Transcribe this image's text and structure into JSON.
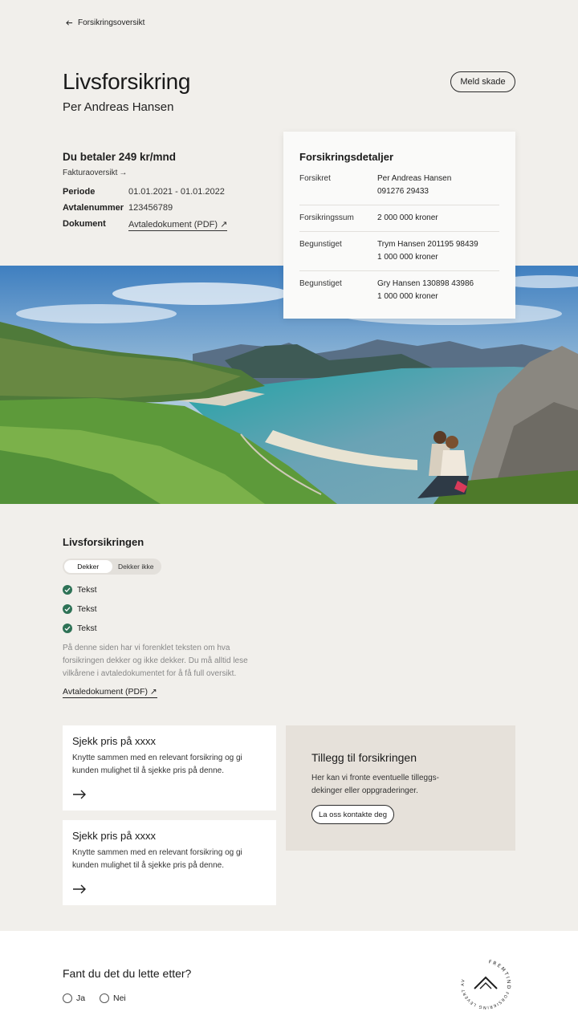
{
  "nav": {
    "back_label": "Forsikringsoversikt"
  },
  "header": {
    "title": "Livsforsikring",
    "insured_name": "Per  Andreas Hansen",
    "report_button": "Meld skade"
  },
  "summary": {
    "payment": "Du betaler 249 kr/mnd",
    "invoice_link": "Fakturaoversikt",
    "rows": [
      {
        "label": "Periode",
        "value": "01.01.2021 - 01.01.2022"
      },
      {
        "label": "Avtalenummer",
        "value": "123456789"
      },
      {
        "label": "Dokument",
        "value": "Avtaledokument (PDF)"
      }
    ]
  },
  "details": {
    "title": "Forsikringsdetaljer",
    "rows": [
      {
        "label": "Forsikret",
        "line1": "Per Andreas Hansen",
        "line2": "091276 29433"
      },
      {
        "label": "Forsikringssum",
        "line1": "2 000 000 kroner",
        "line2": ""
      },
      {
        "label": "Begunstiget",
        "line1": "Trym Hansen  201195 98439",
        "line2": "1 000 000 kroner"
      },
      {
        "label": "Begunstiget",
        "line1": "Gry Hansen 130898 43986",
        "line2": "1 000 000 kroner"
      }
    ]
  },
  "coverage": {
    "title": "Livsforsikringen",
    "tabs": [
      "Dekker",
      "Dekker ikke"
    ],
    "items": [
      "Tekst",
      "Tekst",
      "Tekst"
    ],
    "description": "På denne siden har vi forenklet teksten om hva forsikringen dekker og ikke dekker. Du må alltid lese vilkårene  i avtaledokumentet for å få full oversikt.",
    "doc_link": "Avtaledokument (PDF)"
  },
  "promo_cards": [
    {
      "title": "Sjekk pris på xxxx",
      "text": "Knytte sammen med en relevant forsikring og gi kunden mulighet til å sjekke pris på denne."
    },
    {
      "title": "Sjekk pris på xxxx",
      "text": "Knytte sammen med en relevant forsikring og gi kunden mulighet til å sjekke pris på denne."
    }
  ],
  "addon": {
    "title": "Tillegg til forsikringen",
    "text": "Her kan vi fronte eventuelle tilleggs-dekinger eller oppgraderinger.",
    "button": "La oss kontakte deg"
  },
  "feedback": {
    "question": "Fant du det du lette etter?",
    "options": [
      "Ja",
      "Nei"
    ]
  },
  "logo": {
    "top_text": "FREMTIND",
    "ring_text": "FORSIKRING LEVERT AV"
  },
  "colors": {
    "background": "#f1efeb",
    "check_green": "#2e7256",
    "addon_bg": "#e6e1da"
  }
}
